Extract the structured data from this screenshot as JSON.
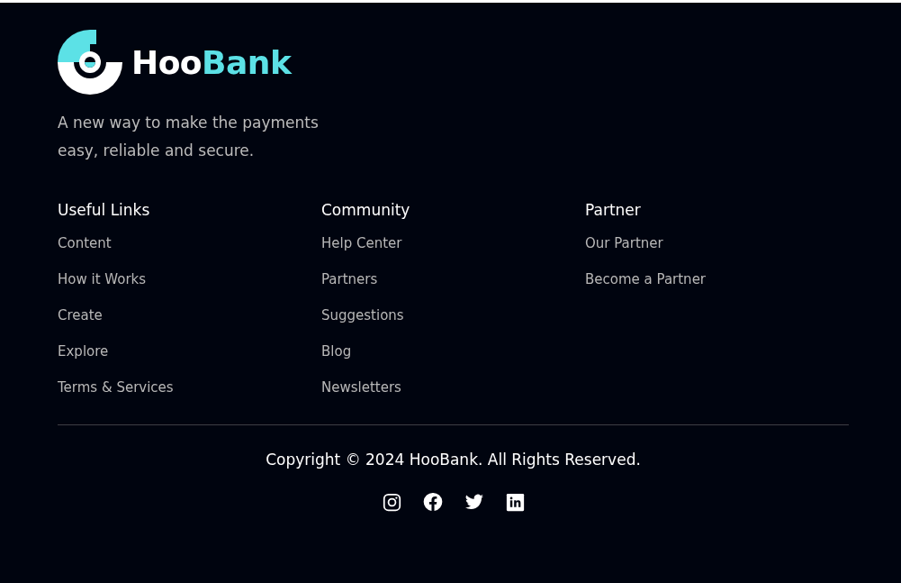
{
  "logo": {
    "text_primary": "Hoo",
    "text_accent": "Bank"
  },
  "tagline": "A new way to make the payments easy, reliable and secure.",
  "link_groups": [
    {
      "title": "Useful Links",
      "links": [
        "Content",
        "How it Works",
        "Create",
        "Explore",
        "Terms & Services"
      ]
    },
    {
      "title": "Community",
      "links": [
        "Help Center",
        "Partners",
        "Suggestions",
        "Blog",
        "Newsletters"
      ]
    },
    {
      "title": "Partner",
      "links": [
        "Our Partner",
        "Become a Partner"
      ]
    }
  ],
  "copyright": "Copyright © 2024 HooBank. All Rights Reserved.",
  "social": [
    {
      "kind": "instagram"
    },
    {
      "kind": "facebook"
    },
    {
      "kind": "twitter"
    },
    {
      "kind": "linkedin"
    }
  ]
}
